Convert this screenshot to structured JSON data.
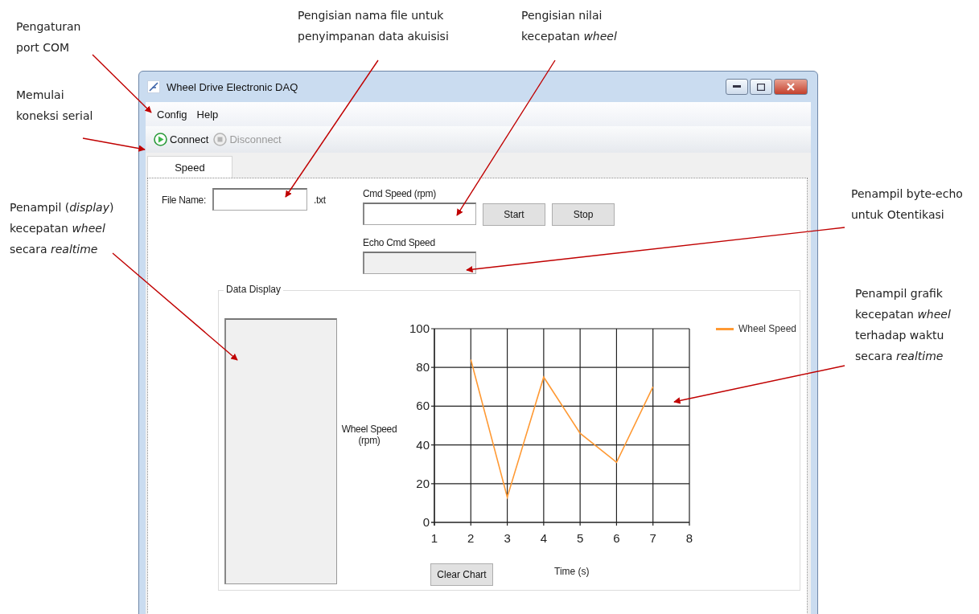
{
  "annotations": [
    {
      "text": "Pengaturan\nport COM"
    },
    {
      "text": "Memulai\nkoneksi serial"
    },
    {
      "text": "Pengisian nama file untuk\npenyimpanan  data akuisisi"
    },
    {
      "text": "Pengisian nilai\nkecepatan *wheel*"
    },
    {
      "text": "Penampil (*display*)\nkecepatan *wheel*\nsecara *realtime*"
    },
    {
      "text": "Penampil byte-echo\nuntuk Otentikasi"
    },
    {
      "text": "Penampil grafik\nkecepatan *wheel*\nterhadap waktu\nsecara *realtime*"
    }
  ],
  "window": {
    "title": "Wheel Drive Electronic DAQ"
  },
  "menu": [
    {
      "label": "Config"
    },
    {
      "label": "Help"
    }
  ],
  "toolbar": [
    {
      "label": "Connect",
      "kind": "play",
      "disabled": false
    },
    {
      "label": "Disconnect",
      "kind": "stop",
      "disabled": true
    }
  ],
  "tabs": [
    {
      "label": "Speed",
      "selected": true
    }
  ],
  "file_name": {
    "label": "File Name:",
    "suffix": ".txt"
  },
  "cmd_speed": {
    "label": "Cmd Speed (rpm)"
  },
  "buttons": [
    {
      "label": "Start"
    },
    {
      "label": "Stop"
    }
  ],
  "echo": {
    "label": "Echo Cmd Speed",
    "disabled": true
  },
  "data_display": {
    "title": "Data Display",
    "clear_button": "Clear Chart",
    "chart_data": {
      "type": "line",
      "xlabel": "Time (s)",
      "ylabel": "Wheel Speed (rpm)",
      "x": [
        2,
        3,
        4,
        5,
        6,
        7
      ],
      "series": [
        {
          "name": "Wheel Speed",
          "color": "#ff9933",
          "values": [
            84,
            13,
            75,
            46,
            31,
            70
          ]
        }
      ],
      "grid": true,
      "xlim": [
        1,
        8
      ],
      "ylim": [
        0,
        100
      ],
      "xticks": [
        1,
        2,
        3,
        4,
        5,
        6,
        7,
        8
      ],
      "yticks": [
        0,
        20,
        40,
        60,
        80,
        100
      ]
    }
  }
}
